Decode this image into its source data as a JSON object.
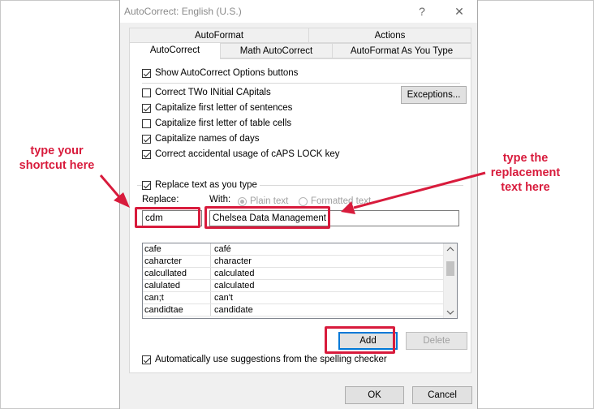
{
  "window": {
    "title": "AutoCorrect: English (U.S.)",
    "help_glyph": "?",
    "close_glyph": "✕"
  },
  "tabs": {
    "row1": [
      "AutoFormat",
      "Actions"
    ],
    "row2": [
      "AutoCorrect",
      "Math AutoCorrect",
      "AutoFormat As You Type"
    ],
    "active": "AutoCorrect"
  },
  "options": {
    "show_buttons": "Show AutoCorrect Options buttons",
    "two_initial": "Correct TWo INitial CApitals",
    "first_sentence": "Capitalize first letter of sentences",
    "first_table": "Capitalize first letter of table cells",
    "names_days": "Capitalize names of days",
    "caps_lock": "Correct accidental usage of cAPS LOCK key",
    "replace_as_you_type": "Replace text as you type",
    "auto_suggest": "Automatically use suggestions from the spelling checker"
  },
  "exceptions_label": "Exceptions...",
  "replace": {
    "replace_label": "Replace:",
    "with_label": "With:",
    "plain_text": "Plain text",
    "formatted_text": "Formatted text",
    "replace_value": "cdm",
    "with_value": "Chelsea Data Management"
  },
  "entries": [
    [
      "cafe",
      "café"
    ],
    [
      "caharcter",
      "character"
    ],
    [
      "calcullated",
      "calculated"
    ],
    [
      "calulated",
      "calculated"
    ],
    [
      "can;t",
      "can't"
    ],
    [
      "candidtae",
      "candidate"
    ]
  ],
  "buttons": {
    "add": "Add",
    "delete": "Delete",
    "ok": "OK",
    "cancel": "Cancel"
  },
  "annotations": {
    "left": [
      "type your",
      "shortcut here"
    ],
    "right": [
      "type the",
      "replacement",
      "text here"
    ]
  },
  "colors": {
    "annotation_red": "#d81b3c",
    "focus_blue": "#0078d7"
  }
}
